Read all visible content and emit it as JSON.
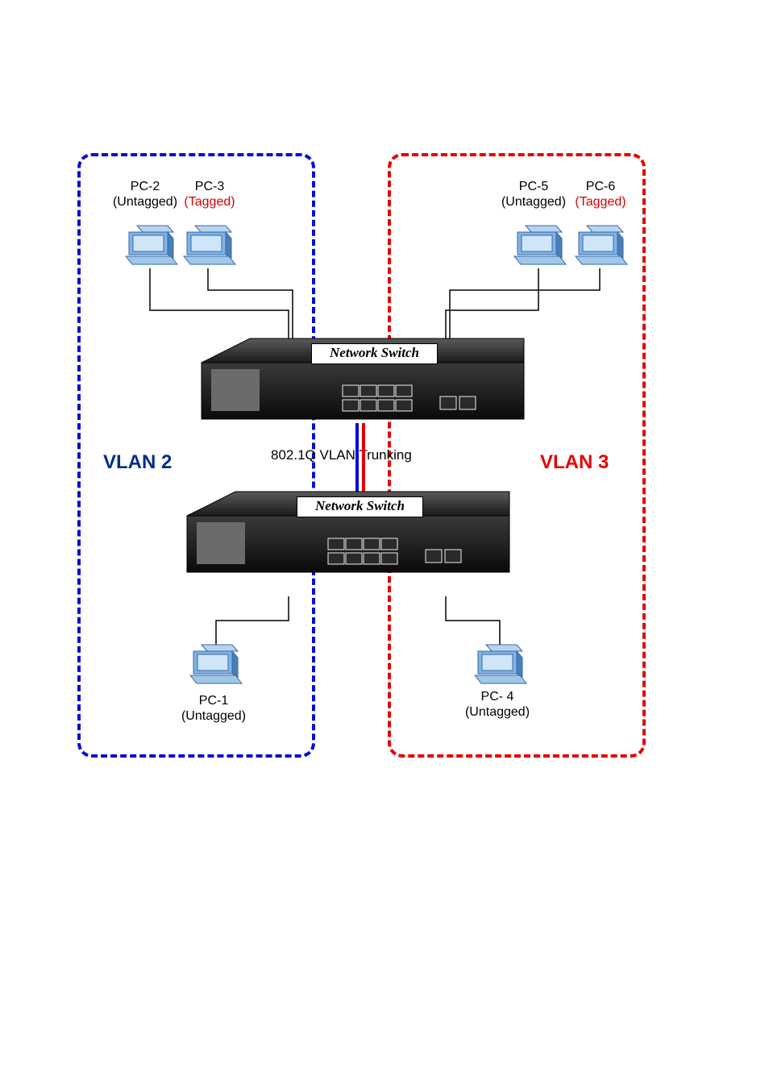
{
  "vlans": {
    "left": {
      "title": "VLAN 2",
      "color": "#0a0ad6"
    },
    "right": {
      "title": "VLAN 3",
      "color": "#e60000"
    }
  },
  "trunk_label": "802.1Q VLAN Trunking",
  "switches": {
    "top": {
      "label": "Network Switch"
    },
    "bottom": {
      "label": "Network Switch"
    }
  },
  "pcs": {
    "pc2": {
      "name": "PC-2",
      "tag": "(Untagged)",
      "tag_class": "black"
    },
    "pc3": {
      "name": "PC-3",
      "tag": "(Tagged)",
      "tag_class": "tagged"
    },
    "pc5": {
      "name": "PC-5",
      "tag": "(Untagged)",
      "tag_class": "black"
    },
    "pc6": {
      "name": "PC-6",
      "tag": "(Tagged)",
      "tag_class": "tagged"
    },
    "pc1": {
      "name": "PC-1",
      "tag": "(Untagged)",
      "tag_class": "black"
    },
    "pc4": {
      "name": "PC- 4",
      "tag": "(Untagged)",
      "tag_class": "black"
    }
  }
}
